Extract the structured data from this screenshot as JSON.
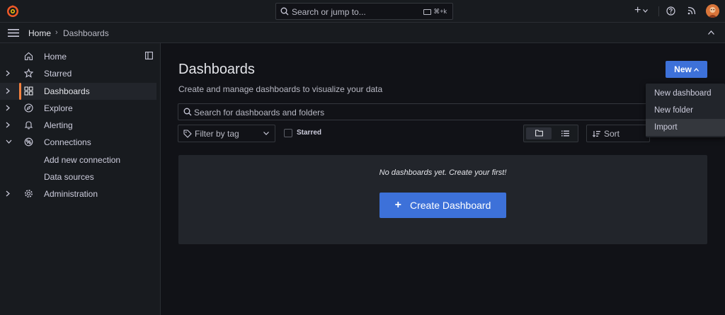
{
  "topbar": {
    "search_placeholder": "Search or jump to...",
    "shortcut": "⌘+k",
    "add_symbol": "+"
  },
  "breadcrumb": {
    "home": "Home",
    "separator": "›",
    "current": "Dashboards"
  },
  "sidebar": {
    "items": [
      {
        "label": "Home",
        "icon": "home-icon"
      },
      {
        "label": "Starred",
        "icon": "star-icon"
      },
      {
        "label": "Dashboards",
        "icon": "apps-icon"
      },
      {
        "label": "Explore",
        "icon": "compass-icon"
      },
      {
        "label": "Alerting",
        "icon": "bell-icon"
      },
      {
        "label": "Connections",
        "icon": "link-icon"
      },
      {
        "label": "Add new connection",
        "icon": ""
      },
      {
        "label": "Data sources",
        "icon": ""
      },
      {
        "label": "Administration",
        "icon": "cog-icon"
      }
    ]
  },
  "main": {
    "title": "Dashboards",
    "subtitle": "Create and manage dashboards to visualize your data",
    "new_button": "New",
    "search_placeholder": "Search for dashboards and folders",
    "tag_filter": "Filter by tag",
    "starred_label": "Starred",
    "sort_label": "Sort",
    "empty_message": "No dashboards yet. Create your first!",
    "create_button": "Create Dashboard",
    "create_plus": "+"
  },
  "new_menu": {
    "items": [
      "New dashboard",
      "New folder",
      "Import"
    ],
    "hovered": "Import"
  },
  "colors": {
    "accent": "#3d71d9",
    "active_indicator": "#f5813f",
    "background": "#111217",
    "panel": "#181b1f"
  }
}
